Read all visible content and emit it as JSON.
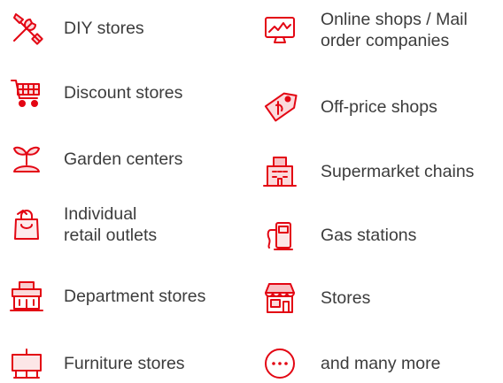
{
  "accent_color": "#e30613",
  "categories": [
    {
      "label": "DIY stores",
      "icon": "tools-icon"
    },
    {
      "label": "Discount stores",
      "icon": "shopping-cart-icon"
    },
    {
      "label": "Garden centers",
      "icon": "plant-sprout-icon"
    },
    {
      "label": "Individual\nretail outlets",
      "icon": "shopping-bag-icon"
    },
    {
      "label": "Department stores",
      "icon": "department-store-icon"
    },
    {
      "label": "Furniture stores",
      "icon": "furniture-icon"
    },
    {
      "label": "Online shops / Mail\norder companies",
      "icon": "monitor-chart-icon"
    },
    {
      "label": "Off-price shops",
      "icon": "price-tag-icon"
    },
    {
      "label": "Supermarket chains",
      "icon": "supermarket-building-icon"
    },
    {
      "label": "Gas stations",
      "icon": "fuel-pump-icon"
    },
    {
      "label": "Stores",
      "icon": "storefront-icon"
    },
    {
      "label": "and many more",
      "icon": "more-dots-icon"
    }
  ]
}
